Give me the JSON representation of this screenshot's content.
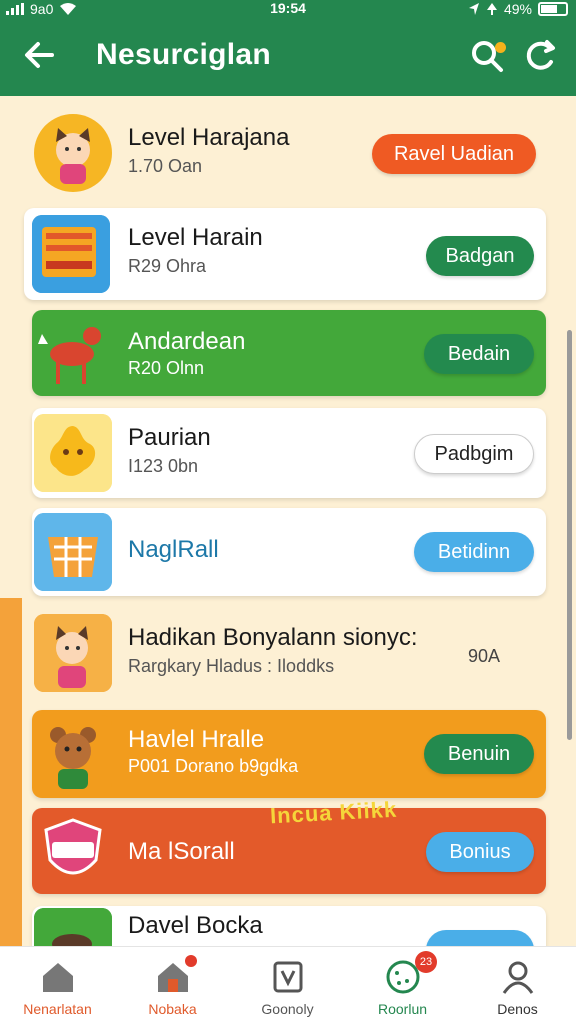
{
  "status": {
    "carrier": "9a0",
    "time": "19:54",
    "battery": "49%"
  },
  "header": {
    "title": "Nesurciglan"
  },
  "items": [
    {
      "name": "Level Harajana",
      "sub": "1.70 Oan",
      "button": "Ravel Uadian"
    },
    {
      "name": "Level Harain",
      "sub": "R29 Ohra",
      "button": "Badgan"
    },
    {
      "name": "Andardean",
      "sub": "R20 Olnn",
      "button": "Bedain"
    },
    {
      "name": "Paurian",
      "sub": "I123 0bn",
      "button": "Padbgim"
    },
    {
      "name": "NaglRall",
      "sub": "",
      "button": "Betidinn"
    },
    {
      "name": "Hadikan Bonyalann sionyc:",
      "sub": "Rargkary Hladus : Iloddks",
      "button": "90A"
    },
    {
      "name": "Havlel Hralle",
      "sub": "P001 Dorano b9gdka",
      "button": "Benuin"
    },
    {
      "name": "Ma lSorall",
      "sub": "",
      "button": "Bonius"
    },
    {
      "name": "Davel Bocka",
      "sub": "",
      "button": ""
    }
  ],
  "overlay_text": "Incua Kiikk",
  "nav": [
    {
      "label": "Nenarlatan",
      "color": "#e05a2b"
    },
    {
      "label": "Nobaka",
      "color": "#e05a2b",
      "badge": ""
    },
    {
      "label": "Goonoly",
      "color": "#555555"
    },
    {
      "label": "Roorlun",
      "color": "#24874f",
      "badge": "23"
    },
    {
      "label": "Denos",
      "color": "#333333"
    }
  ]
}
